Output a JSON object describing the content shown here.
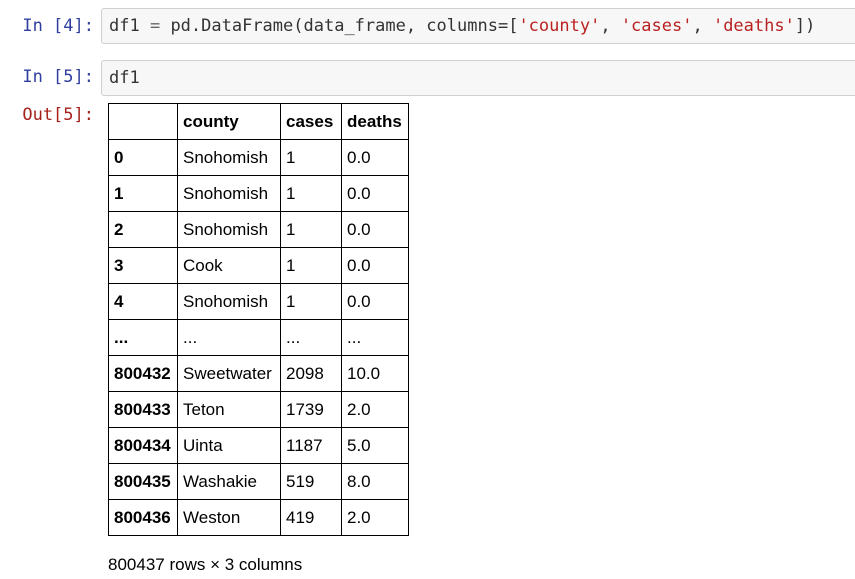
{
  "cells": [
    {
      "prompt": "In [4]:",
      "code_tokens": [
        {
          "text": "df1 ",
          "cls": "plain"
        },
        {
          "text": "=",
          "cls": "op"
        },
        {
          "text": " pd.DataFrame(data_frame, columns=[",
          "cls": "plain"
        },
        {
          "text": "'county'",
          "cls": "str"
        },
        {
          "text": ", ",
          "cls": "plain"
        },
        {
          "text": "'cases'",
          "cls": "str"
        },
        {
          "text": ", ",
          "cls": "plain"
        },
        {
          "text": "'deaths'",
          "cls": "str"
        },
        {
          "text": "])",
          "cls": "plain"
        }
      ]
    },
    {
      "prompt": "In [5]:",
      "code_tokens": [
        {
          "text": "df1",
          "cls": "plain"
        }
      ]
    }
  ],
  "output": {
    "prompt": "Out[5]:",
    "table": {
      "columns": [
        "",
        "county",
        "cases",
        "deaths"
      ],
      "rows": [
        [
          "0",
          "Snohomish",
          "1",
          "0.0"
        ],
        [
          "1",
          "Snohomish",
          "1",
          "0.0"
        ],
        [
          "2",
          "Snohomish",
          "1",
          "0.0"
        ],
        [
          "3",
          "Cook",
          "1",
          "0.0"
        ],
        [
          "4",
          "Snohomish",
          "1",
          "0.0"
        ],
        [
          "...",
          "...",
          "...",
          "..."
        ],
        [
          "800432",
          "Sweetwater",
          "2098",
          "10.0"
        ],
        [
          "800433",
          "Teton",
          "1739",
          "2.0"
        ],
        [
          "800434",
          "Uinta",
          "1187",
          "5.0"
        ],
        [
          "800435",
          "Washakie",
          "519",
          "8.0"
        ],
        [
          "800436",
          "Weston",
          "419",
          "2.0"
        ]
      ]
    },
    "shape_note": "800437 rows × 3 columns"
  },
  "colors": {
    "in_prompt": "#303f9f",
    "out_prompt": "#a5221b",
    "string": "#ba2121",
    "cell_bg": "#f7f7f7"
  }
}
